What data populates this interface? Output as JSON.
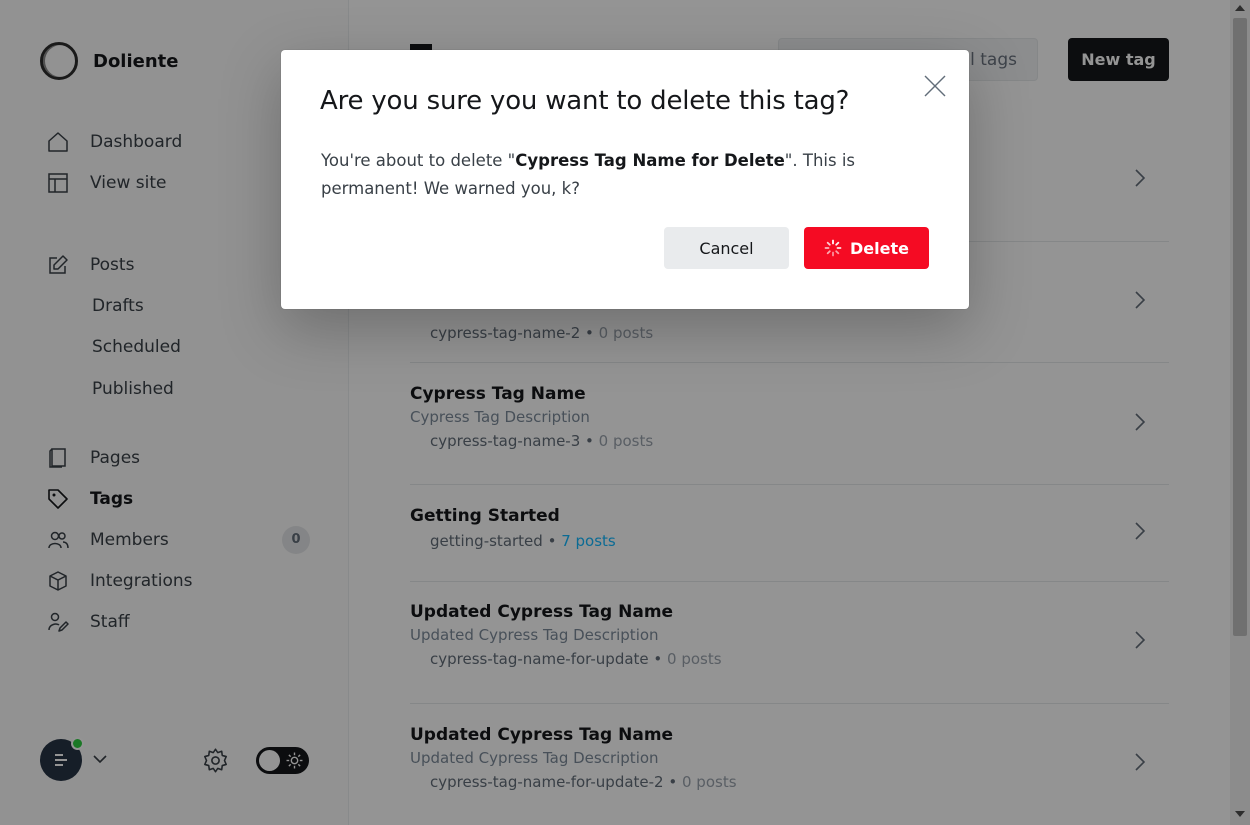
{
  "app": {
    "name": "Doliente"
  },
  "sidebar": {
    "items": [
      {
        "label": "Dashboard",
        "icon": "home-icon"
      },
      {
        "label": "View site",
        "icon": "layout-icon"
      },
      {
        "label": "Posts",
        "icon": "pencil-square-icon"
      },
      {
        "label": "Drafts"
      },
      {
        "label": "Scheduled"
      },
      {
        "label": "Published"
      },
      {
        "label": "Pages",
        "icon": "page-icon"
      },
      {
        "label": "Tags",
        "icon": "tag-icon",
        "active": true
      },
      {
        "label": "Members",
        "icon": "members-icon",
        "badge": "0"
      },
      {
        "label": "Integrations",
        "icon": "cube-icon"
      },
      {
        "label": "Staff",
        "icon": "staff-icon"
      }
    ]
  },
  "header": {
    "filter_label": "al tags",
    "new_tag_label": "New tag"
  },
  "tags": [
    {
      "name": "",
      "description": "",
      "slug": "",
      "count": ""
    },
    {
      "name": "",
      "description": "",
      "slug": "cypress-tag-name-2",
      "count": "0 posts"
    },
    {
      "name": "Cypress Tag Name",
      "description": "Cypress Tag Description",
      "slug": "cypress-tag-name-3",
      "count": "0 posts"
    },
    {
      "name": "Getting Started",
      "description": "",
      "slug": "getting-started",
      "count": "7 posts"
    },
    {
      "name": "Updated Cypress Tag Name",
      "description": "Updated Cypress Tag Description",
      "slug": "cypress-tag-name-for-update",
      "count": "0 posts"
    },
    {
      "name": "Updated Cypress Tag Name",
      "description": "Updated Cypress Tag Description",
      "slug": "cypress-tag-name-for-update-2",
      "count": "0 posts"
    }
  ],
  "modal": {
    "title": "Are you sure you want to delete this tag?",
    "body_prefix": "You're about to delete \"",
    "tag_name": "Cypress Tag Name for Delete",
    "body_suffix": "\". This is permanent! We warned you, k?",
    "cancel_label": "Cancel",
    "delete_label": "Delete"
  },
  "colors": {
    "accent": "#14b8ff",
    "danger": "#f50b23",
    "dark": "#15171a",
    "online": "#30cf43"
  }
}
